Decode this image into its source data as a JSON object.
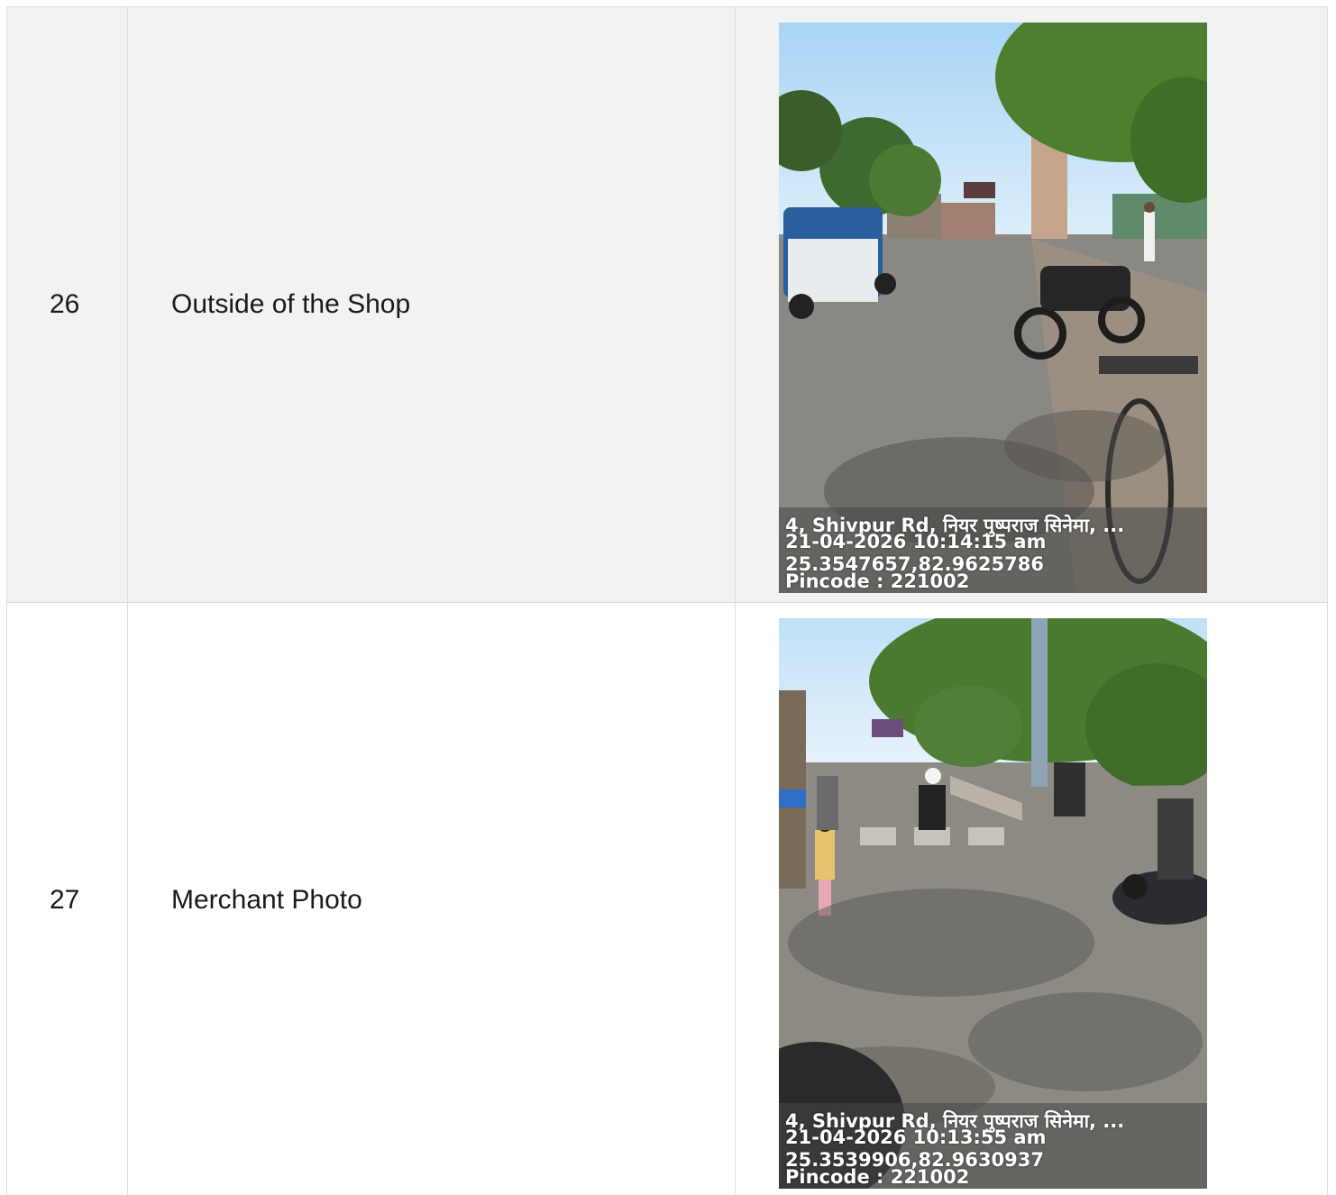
{
  "rows": [
    {
      "number": "26",
      "label": "Outside of the Shop",
      "photo": {
        "address": "4, Shivpur Rd, नियर पुष्पराज सिनेमा, ...",
        "datetime": "21-04-2026 10:14:15 am",
        "coordinates": "25.3547657,82.9625786",
        "pincode": "Pincode : 221002"
      }
    },
    {
      "number": "27",
      "label": "Merchant Photo",
      "photo": {
        "address": "4, Shivpur Rd, नियर पुष्पराज सिनेमा, ...",
        "datetime": "21-04-2026 10:13:55 am",
        "coordinates": "25.3539906,82.9630937",
        "pincode": "Pincode : 221002"
      }
    }
  ],
  "colors": {
    "row_alt_background": "#f2f2f2",
    "border": "#dcdcdc",
    "text": "#1a1a1a"
  }
}
